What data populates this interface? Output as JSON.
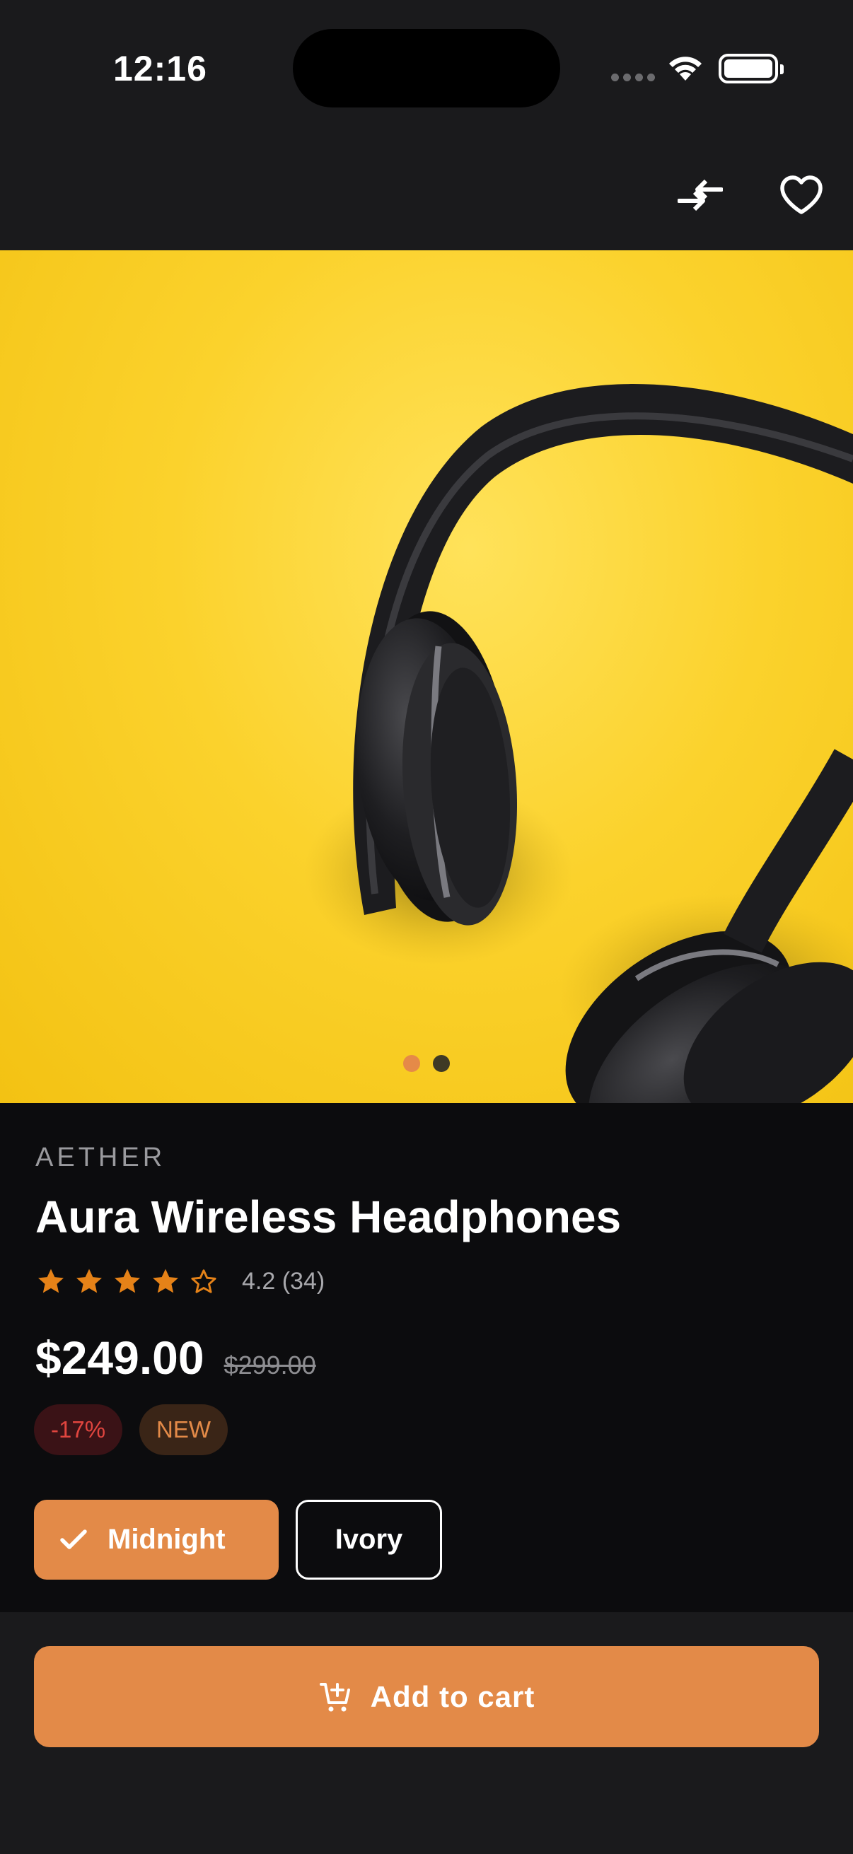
{
  "status_bar": {
    "time": "12:16"
  },
  "top_bar": {
    "compare_icon": "compare-arrows-icon",
    "favorite_icon": "heart-outline-icon"
  },
  "gallery": {
    "image": "black over-ear headphones on yellow background",
    "page_count": 2,
    "current_page": 1
  },
  "product": {
    "brand": "AETHER",
    "name": "Aura Wireless Headphones",
    "rating_value": 4.2,
    "rating_text": "4.2 (34)",
    "stars_filled": 4,
    "stars_total": 5,
    "price": "$249.00",
    "original_price": "$299.00",
    "discount_badge": "-17%",
    "new_badge": "NEW"
  },
  "variants": [
    {
      "label": "Midnight",
      "selected": true
    },
    {
      "label": "Ivory",
      "selected": false
    }
  ],
  "cart": {
    "button_label": "Add to cart",
    "icon": "add-shopping-cart-icon"
  },
  "colors": {
    "accent": "#E38A48",
    "background": "#1A1A1C",
    "surface": "#0C0C0E",
    "star": "#E58218",
    "discount_text": "#E0453F"
  }
}
